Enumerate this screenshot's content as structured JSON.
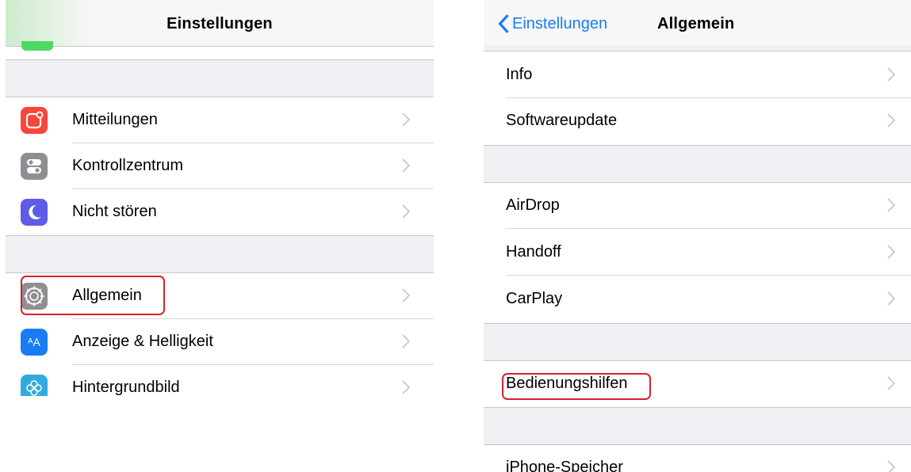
{
  "left": {
    "nav_title": "Einstellungen",
    "items": [
      {
        "label": "Mitteilungen",
        "icon": "notifications-icon",
        "color": "#f9453a"
      },
      {
        "label": "Kontrollzentrum",
        "icon": "control-center-icon",
        "color": "#8e8e93"
      },
      {
        "label": "Nicht stören",
        "icon": "moon-icon",
        "color": "#5e5ce6"
      },
      {
        "label": "Allgemein",
        "icon": "gear-icon",
        "color": "#8e8e93",
        "highlighted": true
      },
      {
        "label": "Anzeige & Helligkeit",
        "icon": "display-brightness-icon",
        "color": "#1a7cf5"
      },
      {
        "label": "Hintergrundbild",
        "icon": "wallpaper-icon",
        "color": "#34aadc"
      }
    ]
  },
  "right": {
    "back_label": "Einstellungen",
    "nav_title": "Allgemein",
    "items": [
      {
        "label": "Info"
      },
      {
        "label": "Softwareupdate"
      },
      {
        "label": "AirDrop"
      },
      {
        "label": "Handoff"
      },
      {
        "label": "CarPlay"
      },
      {
        "label": "Bedienungshilfen",
        "highlighted": true
      },
      {
        "label": "iPhone-Speicher"
      }
    ]
  },
  "colors": {
    "accent": "#1a7cf5",
    "highlight": "#d7212c",
    "group_bg": "#efeff4"
  }
}
